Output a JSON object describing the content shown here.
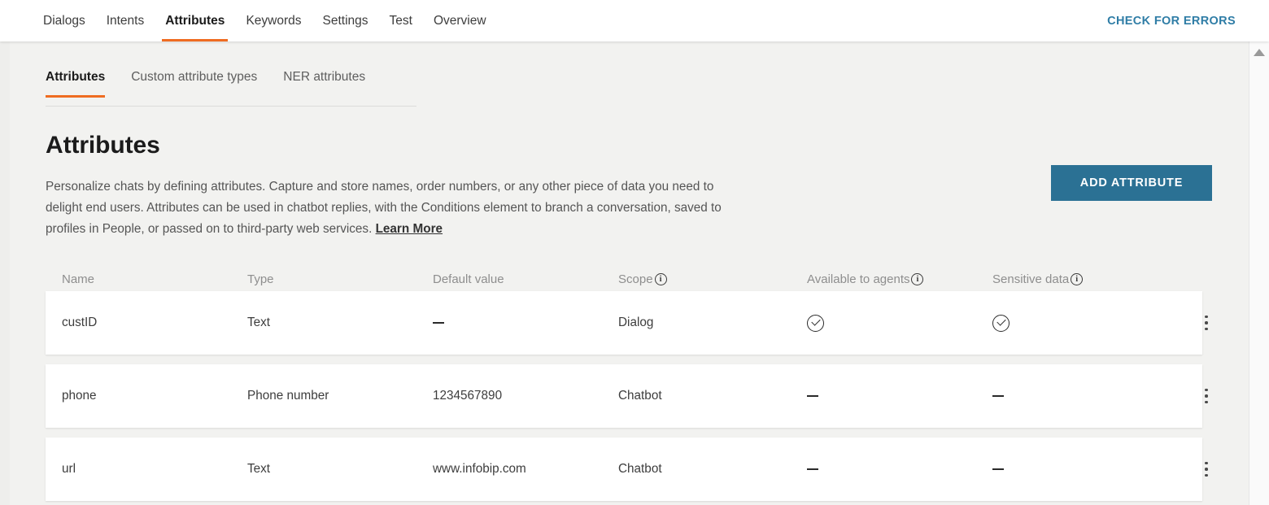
{
  "theme": {
    "accent_orange": "#ef6c21",
    "button_blue": "#2b7194",
    "link_blue": "#2f7da6",
    "page_bg": "#f2f2f0",
    "card_bg": "#ffffff"
  },
  "topbar": {
    "tabs": [
      {
        "label": "Dialogs",
        "active": false
      },
      {
        "label": "Intents",
        "active": false
      },
      {
        "label": "Attributes",
        "active": true
      },
      {
        "label": "Keywords",
        "active": false
      },
      {
        "label": "Settings",
        "active": false
      },
      {
        "label": "Test",
        "active": false
      },
      {
        "label": "Overview",
        "active": false
      }
    ],
    "check_errors_label": "CHECK FOR ERRORS"
  },
  "subtabs": [
    {
      "label": "Attributes",
      "active": true
    },
    {
      "label": "Custom attribute types",
      "active": false
    },
    {
      "label": "NER attributes",
      "active": false
    }
  ],
  "page": {
    "title": "Attributes",
    "description": "Personalize chats by defining attributes. Capture and store names, order numbers, or any other piece of data you need to delight end users. Attributes can be used in chatbot replies, with the Conditions element to branch a conversation, saved to profiles in People, or passed on to third-party web services. ",
    "learn_more_label": "Learn More",
    "add_attribute_label": "ADD ATTRIBUTE"
  },
  "table": {
    "columns": [
      {
        "label": "Name",
        "info": false
      },
      {
        "label": "Type",
        "info": false
      },
      {
        "label": "Default value",
        "info": false
      },
      {
        "label": "Scope",
        "info": true
      },
      {
        "label": "Available to agents",
        "info": true
      },
      {
        "label": "Sensitive data",
        "info": true
      }
    ],
    "info_icon_glyph": "i",
    "rows": [
      {
        "name": "custID",
        "type": "Text",
        "default_value": "—",
        "default_value_is_dash": true,
        "scope": "Dialog",
        "available_to_agents": "check",
        "sensitive_data": "check"
      },
      {
        "name": "phone",
        "type": "Phone number",
        "default_value": "1234567890",
        "default_value_is_dash": false,
        "scope": "Chatbot",
        "available_to_agents": "dash",
        "sensitive_data": "dash"
      },
      {
        "name": "url",
        "type": "Text",
        "default_value": "www.infobip.com",
        "default_value_is_dash": false,
        "scope": "Chatbot",
        "available_to_agents": "dash",
        "sensitive_data": "dash"
      }
    ]
  },
  "scrollbar": {
    "up_arrow_icon": "triangle-up-icon"
  }
}
